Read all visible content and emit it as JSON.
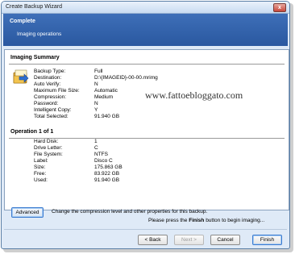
{
  "window": {
    "title": "Create Backup Wizard",
    "close_symbol": "x"
  },
  "header": {
    "title": "Complete",
    "subtitle": "Imaging operations"
  },
  "summary": {
    "title": "Imaging Summary",
    "icon": "backup-icon",
    "rows": [
      {
        "label": "Backup Type:",
        "value": "Full"
      },
      {
        "label": "Destination:",
        "value": "D:\\{IMAGEID}-00-00.mrimg"
      },
      {
        "label": "Auto Verify:",
        "value": "N"
      },
      {
        "label": "Maximum File Size:",
        "value": "Automatic"
      },
      {
        "label": "Compression:",
        "value": "Medium"
      },
      {
        "label": "Password:",
        "value": "N"
      },
      {
        "label": "Intelligent Copy:",
        "value": "Y"
      },
      {
        "label": "Total Selected:",
        "value": "91.940 GB"
      }
    ]
  },
  "operation": {
    "title": "Operation 1 of 1",
    "rows": [
      {
        "label": "Hard Disk:",
        "value": "1"
      },
      {
        "label": "Drive Letter:",
        "value": "C"
      },
      {
        "label": "File System:",
        "value": "NTFS"
      },
      {
        "label": "Label:",
        "value": "Disco C"
      },
      {
        "label": "Size:",
        "value": "175.863 GB"
      },
      {
        "label": "Free:",
        "value": "83.922 GB"
      },
      {
        "label": "Used:",
        "value": "91.940 GB"
      }
    ]
  },
  "watermark": "www.fattoebloggato.com",
  "advanced": {
    "button_label": "Advanced",
    "description": "Change the compression level and other properties for this backup."
  },
  "finish_note": {
    "before": "Please press the",
    "emphasis": "Finish",
    "after": "button to begin imaging..."
  },
  "buttons": {
    "back": "< Back",
    "next": "Next >",
    "cancel": "Cancel",
    "finish": "Finish"
  }
}
